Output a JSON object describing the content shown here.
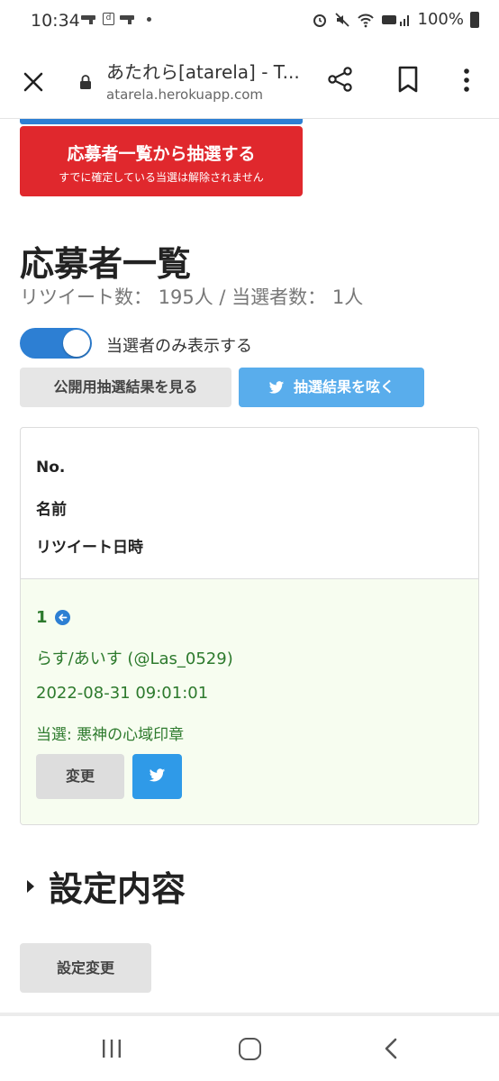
{
  "status_bar": {
    "time": "10:34",
    "battery": "100%"
  },
  "browser": {
    "title": "あたれら[atarela] - T...",
    "url": "atarela.herokuapp.com"
  },
  "draw_button": {
    "label": "応募者一覧から抽選する",
    "sublabel": "すでに確定している当選は解除されません"
  },
  "applicants": {
    "heading": "応募者一覧",
    "counts": "リツイート数： 195人 / 当選者数： 1人",
    "toggle_label": "当選者のみ表示する",
    "toggle_on": true,
    "public_results_button": "公開用抽選結果を見る",
    "tweet_results_button": "抽選結果を呟く"
  },
  "table": {
    "headers": [
      "No.",
      "名前",
      "リツイート日時"
    ],
    "rows": [
      {
        "no": "1",
        "name": "らす/あいす (@Las_0529)",
        "retweet_time": "2022-08-31 09:01:01",
        "prize": "当選: 悪神の心域印章",
        "change_button": "変更"
      }
    ]
  },
  "settings": {
    "heading": "設定内容",
    "change_button": "設定変更"
  },
  "colors": {
    "accent_blue": "#2d7fd3",
    "danger_red": "#e0282d",
    "twitter_blue": "#59adec",
    "winner_green": "#2d7a2d",
    "winner_row_bg": "#f7fdf0"
  }
}
